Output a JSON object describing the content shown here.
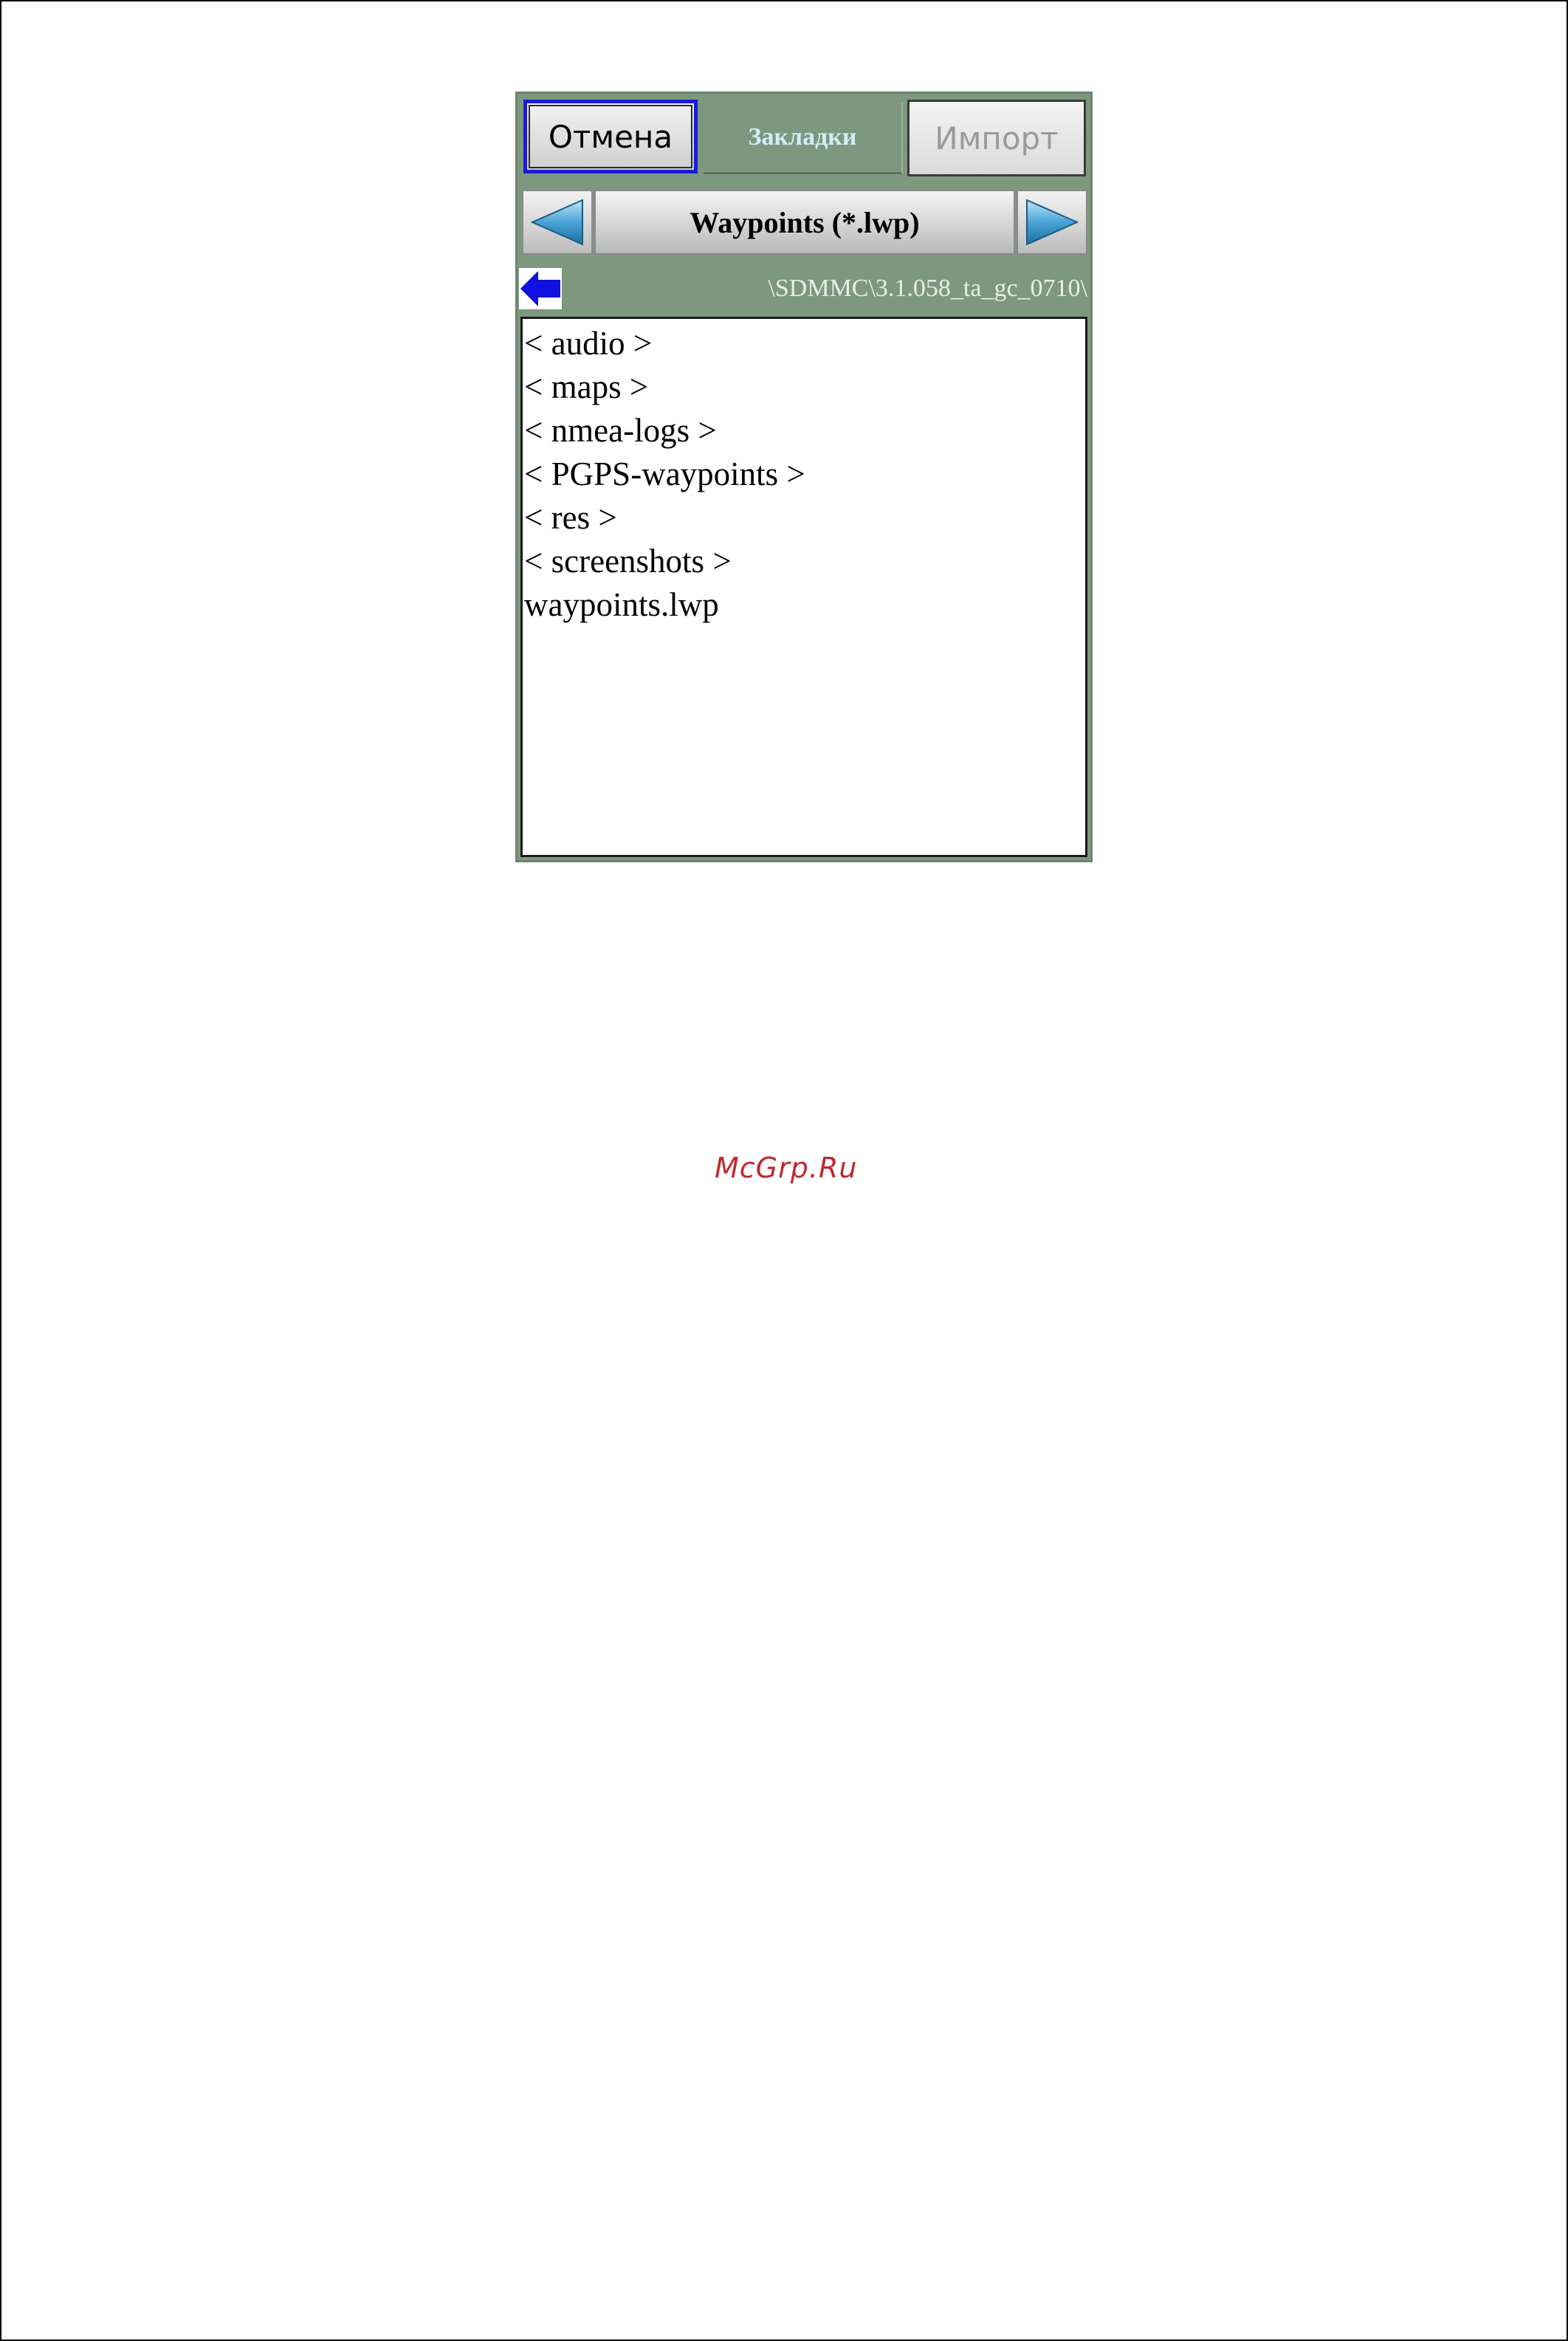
{
  "toolbar": {
    "cancel_label": "Отмена",
    "bookmarks_label": "Закладки",
    "import_label": "Импорт"
  },
  "filter": {
    "label": "Waypoints (*.lwp)",
    "prev_icon": "triangle-left-icon",
    "next_icon": "triangle-right-icon"
  },
  "path": {
    "back_icon": "back-arrow-icon",
    "current": "\\SDMMC\\3.1.058_ta_gc_0710\\"
  },
  "files": [
    "< audio >",
    "< maps >",
    "< nmea-logs >",
    "< PGPS-waypoints >",
    "< res >",
    "< screenshots >",
    "waypoints.lwp"
  ],
  "watermark": "McGrp.Ru",
  "colors": {
    "panel_bg": "#7e9880",
    "focus_border": "#1b1bd6",
    "arrow_fill": "#2e8bc6",
    "back_arrow": "#1010e0",
    "watermark": "#c0282e"
  }
}
